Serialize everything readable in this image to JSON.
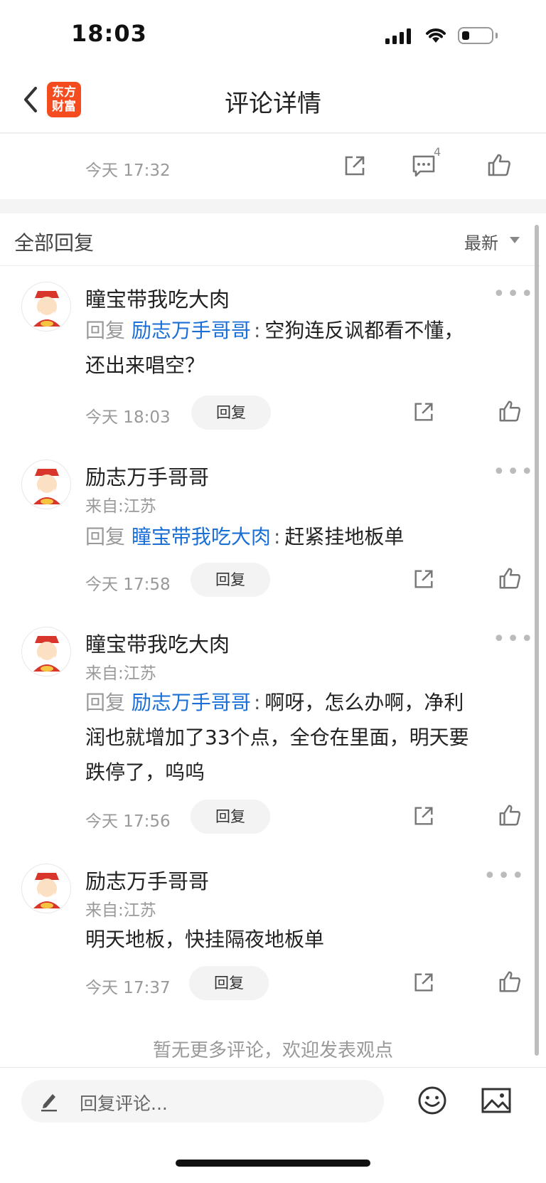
{
  "status_bar": {
    "time": "18:03"
  },
  "nav": {
    "logo_line1": "东方",
    "logo_line2": "财富",
    "title": "评论详情"
  },
  "post": {
    "time": "今天 17:32",
    "comment_count": "4"
  },
  "replies_header": {
    "title": "全部回复",
    "sort_label": "最新"
  },
  "comments": [
    {
      "username": "瞳宝带我吃大肉",
      "location": "",
      "reply_prefix": "回复",
      "reply_target": "励志万手哥哥",
      "text_line1": "空狗连反讽都看不懂，",
      "text_line2": "还出来唱空？",
      "text_line3": "",
      "time": "今天 18:03",
      "reply_label": "回复"
    },
    {
      "username": "励志万手哥哥",
      "location": "来自:江苏",
      "reply_prefix": "回复",
      "reply_target": "瞳宝带我吃大肉",
      "text_line1": "赶紧挂地板单",
      "time": "今天 17:58",
      "reply_label": "回复"
    },
    {
      "username": "瞳宝带我吃大肉",
      "location": "来自:江苏",
      "reply_prefix": "回复",
      "reply_target": "励志万手哥哥",
      "text_line1": "啊呀，怎么办啊，净利",
      "text_line2": "润也就增加了33个点，全仓在里面，明天要",
      "text_line3": "跌停了，呜呜",
      "time": "今天 17:56",
      "reply_label": "回复"
    },
    {
      "username": "励志万手哥哥",
      "location": "来自:江苏",
      "text_line1": "明天地板，快挂隔夜地板单",
      "time": "今天 17:37",
      "reply_label": "回复"
    }
  ],
  "footer": {
    "no_more_text": "暂无更多评论，欢迎发表观点",
    "input_placeholder": "回复评论..."
  },
  "icons": [
    "back-icon",
    "share-icon",
    "comment-icon",
    "like-icon",
    "more-icon",
    "edit-icon",
    "emoji-icon",
    "image-icon"
  ]
}
